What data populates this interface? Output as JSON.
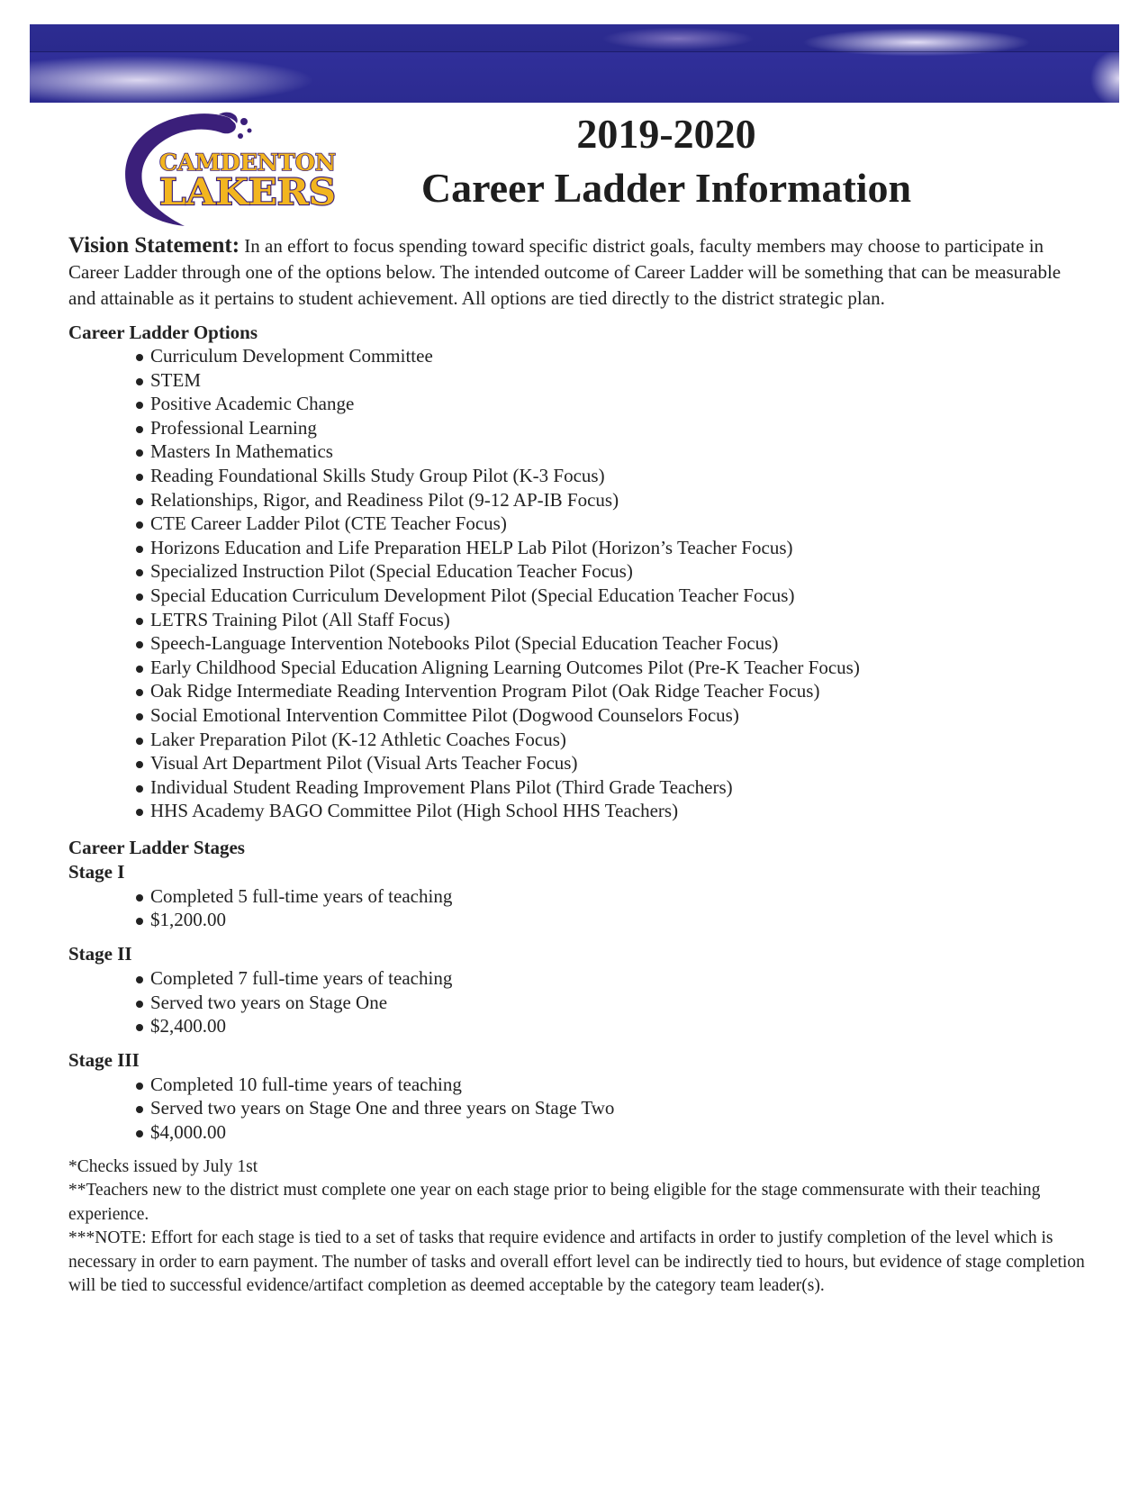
{
  "header": {
    "banner": "decorative-purple-wave-banner",
    "logo": {
      "line1": "CAMDENTON",
      "line2": "LAKERS",
      "colors": {
        "wave": "#3b1f7a",
        "text_fill": "#f2b51f",
        "text_outline": "#3b1f7a"
      }
    },
    "title_year": "2019-2020",
    "title_main": "Career Ladder Information"
  },
  "vision": {
    "label": "Vision Statement:",
    "text": " In an effort to focus spending toward specific district goals, faculty members may choose to participate in Career Ladder through one of the options below.  The intended outcome of Career Ladder will be something that can be measurable and attainable as it pertains to student achievement.  All options are tied directly to the district strategic plan."
  },
  "options": {
    "heading": "Career Ladder Options",
    "items": [
      "Curriculum Development Committee",
      "STEM",
      "Positive Academic Change",
      "Professional Learning",
      "Masters In Mathematics",
      "Reading Foundational Skills Study Group Pilot (K-3 Focus)",
      "Relationships, Rigor, and Readiness Pilot (9-12 AP-IB Focus)",
      "CTE Career Ladder Pilot (CTE Teacher Focus)",
      "Horizons Education and Life Preparation HELP Lab Pilot (Horizon’s Teacher Focus)",
      "Specialized Instruction Pilot (Special Education Teacher Focus)",
      "Special Education Curriculum Development Pilot (Special Education Teacher Focus)",
      "LETRS Training Pilot (All Staff Focus)",
      "Speech-Language Intervention Notebooks Pilot (Special Education Teacher Focus)",
      "Early Childhood Special Education Aligning Learning Outcomes Pilot (Pre-K Teacher Focus)",
      "Oak Ridge Intermediate Reading Intervention Program Pilot (Oak Ridge Teacher Focus)",
      "Social Emotional Intervention Committee Pilot (Dogwood Counselors Focus)",
      "Laker Preparation Pilot (K-12 Athletic Coaches Focus)",
      "Visual Art Department Pilot (Visual Arts Teacher Focus)",
      "Individual Student Reading Improvement Plans Pilot (Third Grade Teachers)",
      "HHS Academy BAGO Committee Pilot (High School HHS Teachers)"
    ]
  },
  "stages": {
    "heading": "Career Ladder Stages",
    "list": [
      {
        "title": "Stage I",
        "items": [
          "Completed 5 full-time years of teaching",
          "$1,200.00"
        ]
      },
      {
        "title": "Stage II",
        "items": [
          "Completed 7 full-time years of teaching",
          "Served two years on Stage One",
          "$2,400.00"
        ]
      },
      {
        "title": "Stage III",
        "items": [
          "Completed 10 full-time years of teaching",
          "Served two years on Stage One and three years on Stage Two",
          "$4,000.00"
        ]
      }
    ]
  },
  "notes": [
    "*Checks issued by July 1st",
    "**Teachers new to the district must complete one year on each stage prior to being eligible for the stage commensurate with their teaching experience.",
    "***NOTE: Effort for each stage is tied to a set of tasks that require evidence and artifacts in order to justify completion of the level which is necessary in order to earn payment.  The number of tasks and overall effort level can be indirectly tied to hours, but evidence of stage completion will be tied to successful evidence/artifact completion as deemed acceptable by the category team leader(s)."
  ]
}
